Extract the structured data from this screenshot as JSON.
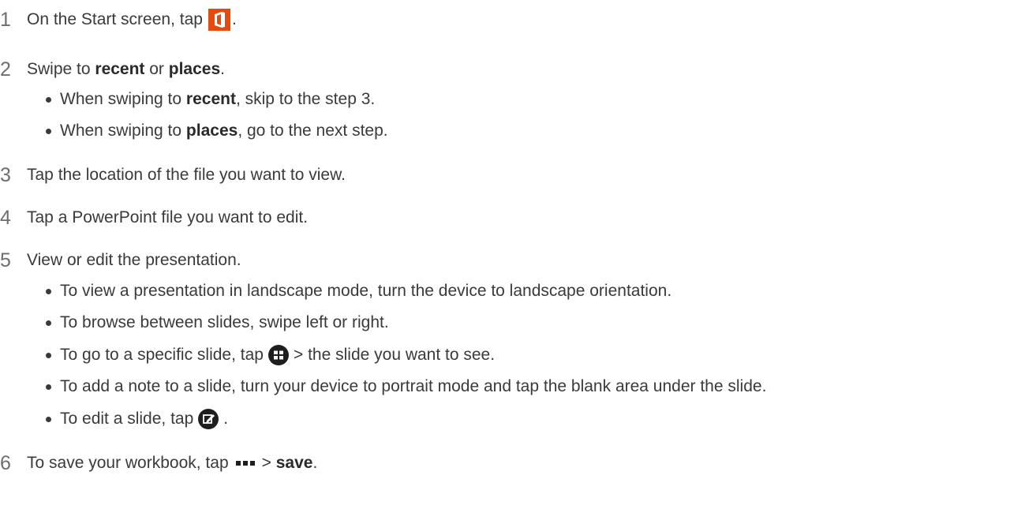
{
  "steps": [
    {
      "num": "1",
      "pre": "On the Start screen, tap",
      "post": ".",
      "icon": "office-icon"
    },
    {
      "num": "2",
      "pre": "Swipe to ",
      "bold1": "recent",
      "mid": " or ",
      "bold2": "places",
      "post": "."
    },
    {
      "num": "3",
      "text": "Tap the location of the file you want to view."
    },
    {
      "num": "4",
      "text": "Tap a PowerPoint file you want to edit."
    },
    {
      "num": "5",
      "text": "View or edit the presentation."
    },
    {
      "num": "6",
      "pre": "To save your workbook, tap",
      "mid": "> ",
      "bold": "save",
      "post": ".",
      "icon": "more-dots-icon"
    }
  ],
  "step2_bullets": [
    {
      "pre": "When swiping to ",
      "bold": "recent",
      "post": ", skip to the step 3."
    },
    {
      "pre": "When swiping to ",
      "bold": "places",
      "post": ", go to the next step."
    }
  ],
  "step5_bullets": [
    {
      "text": "To view a presentation in landscape mode, turn the device to landscape orientation."
    },
    {
      "text": "To browse between slides, swipe left or right."
    },
    {
      "pre": "To go to a specific slide, tap",
      "post": "> the slide you want to see.",
      "icon": "slide-grid-icon"
    },
    {
      "text": "To add a note to a slide, turn your device to portrait mode and tap the blank area under the slide."
    },
    {
      "pre": "To edit a slide, tap",
      "post": ".",
      "icon": "edit-icon"
    }
  ],
  "colors": {
    "office_icon": "#e84a0c",
    "text": "#3a3a3a",
    "step_number": "#6e6e6e"
  }
}
